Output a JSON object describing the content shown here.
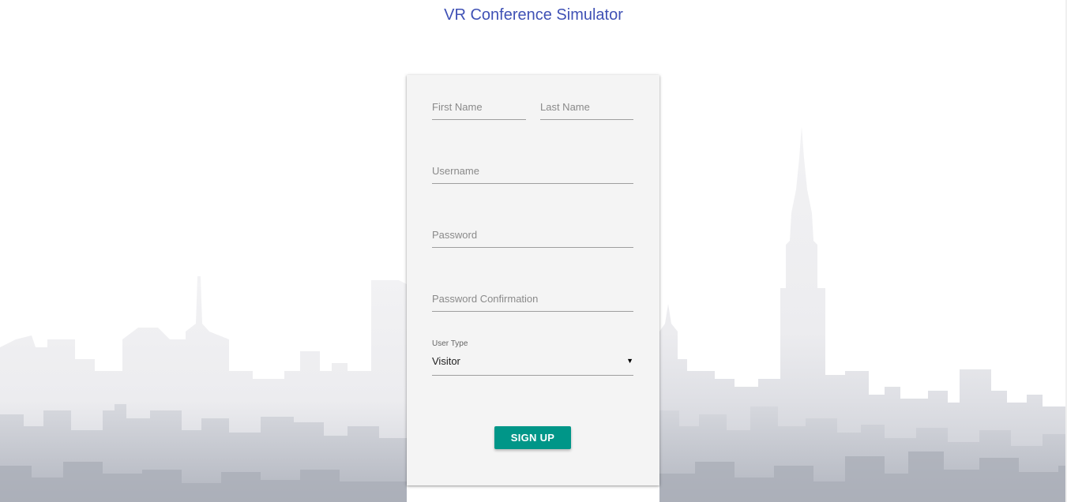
{
  "app": {
    "title": "VR Conference Simulator"
  },
  "form": {
    "first_name_placeholder": "First Name",
    "last_name_placeholder": "Last Name",
    "username_placeholder": "Username",
    "password_placeholder": "Password",
    "password_confirmation_placeholder": "Password Confirmation",
    "user_type": {
      "label": "User Type",
      "selected": "Visitor",
      "arrow": "▼"
    },
    "submit_label": "SIGN UP"
  },
  "colors": {
    "title": "#3f51b5",
    "button": "#009688",
    "card": "#f4f4f4",
    "skyline": "#c9ccd4"
  }
}
